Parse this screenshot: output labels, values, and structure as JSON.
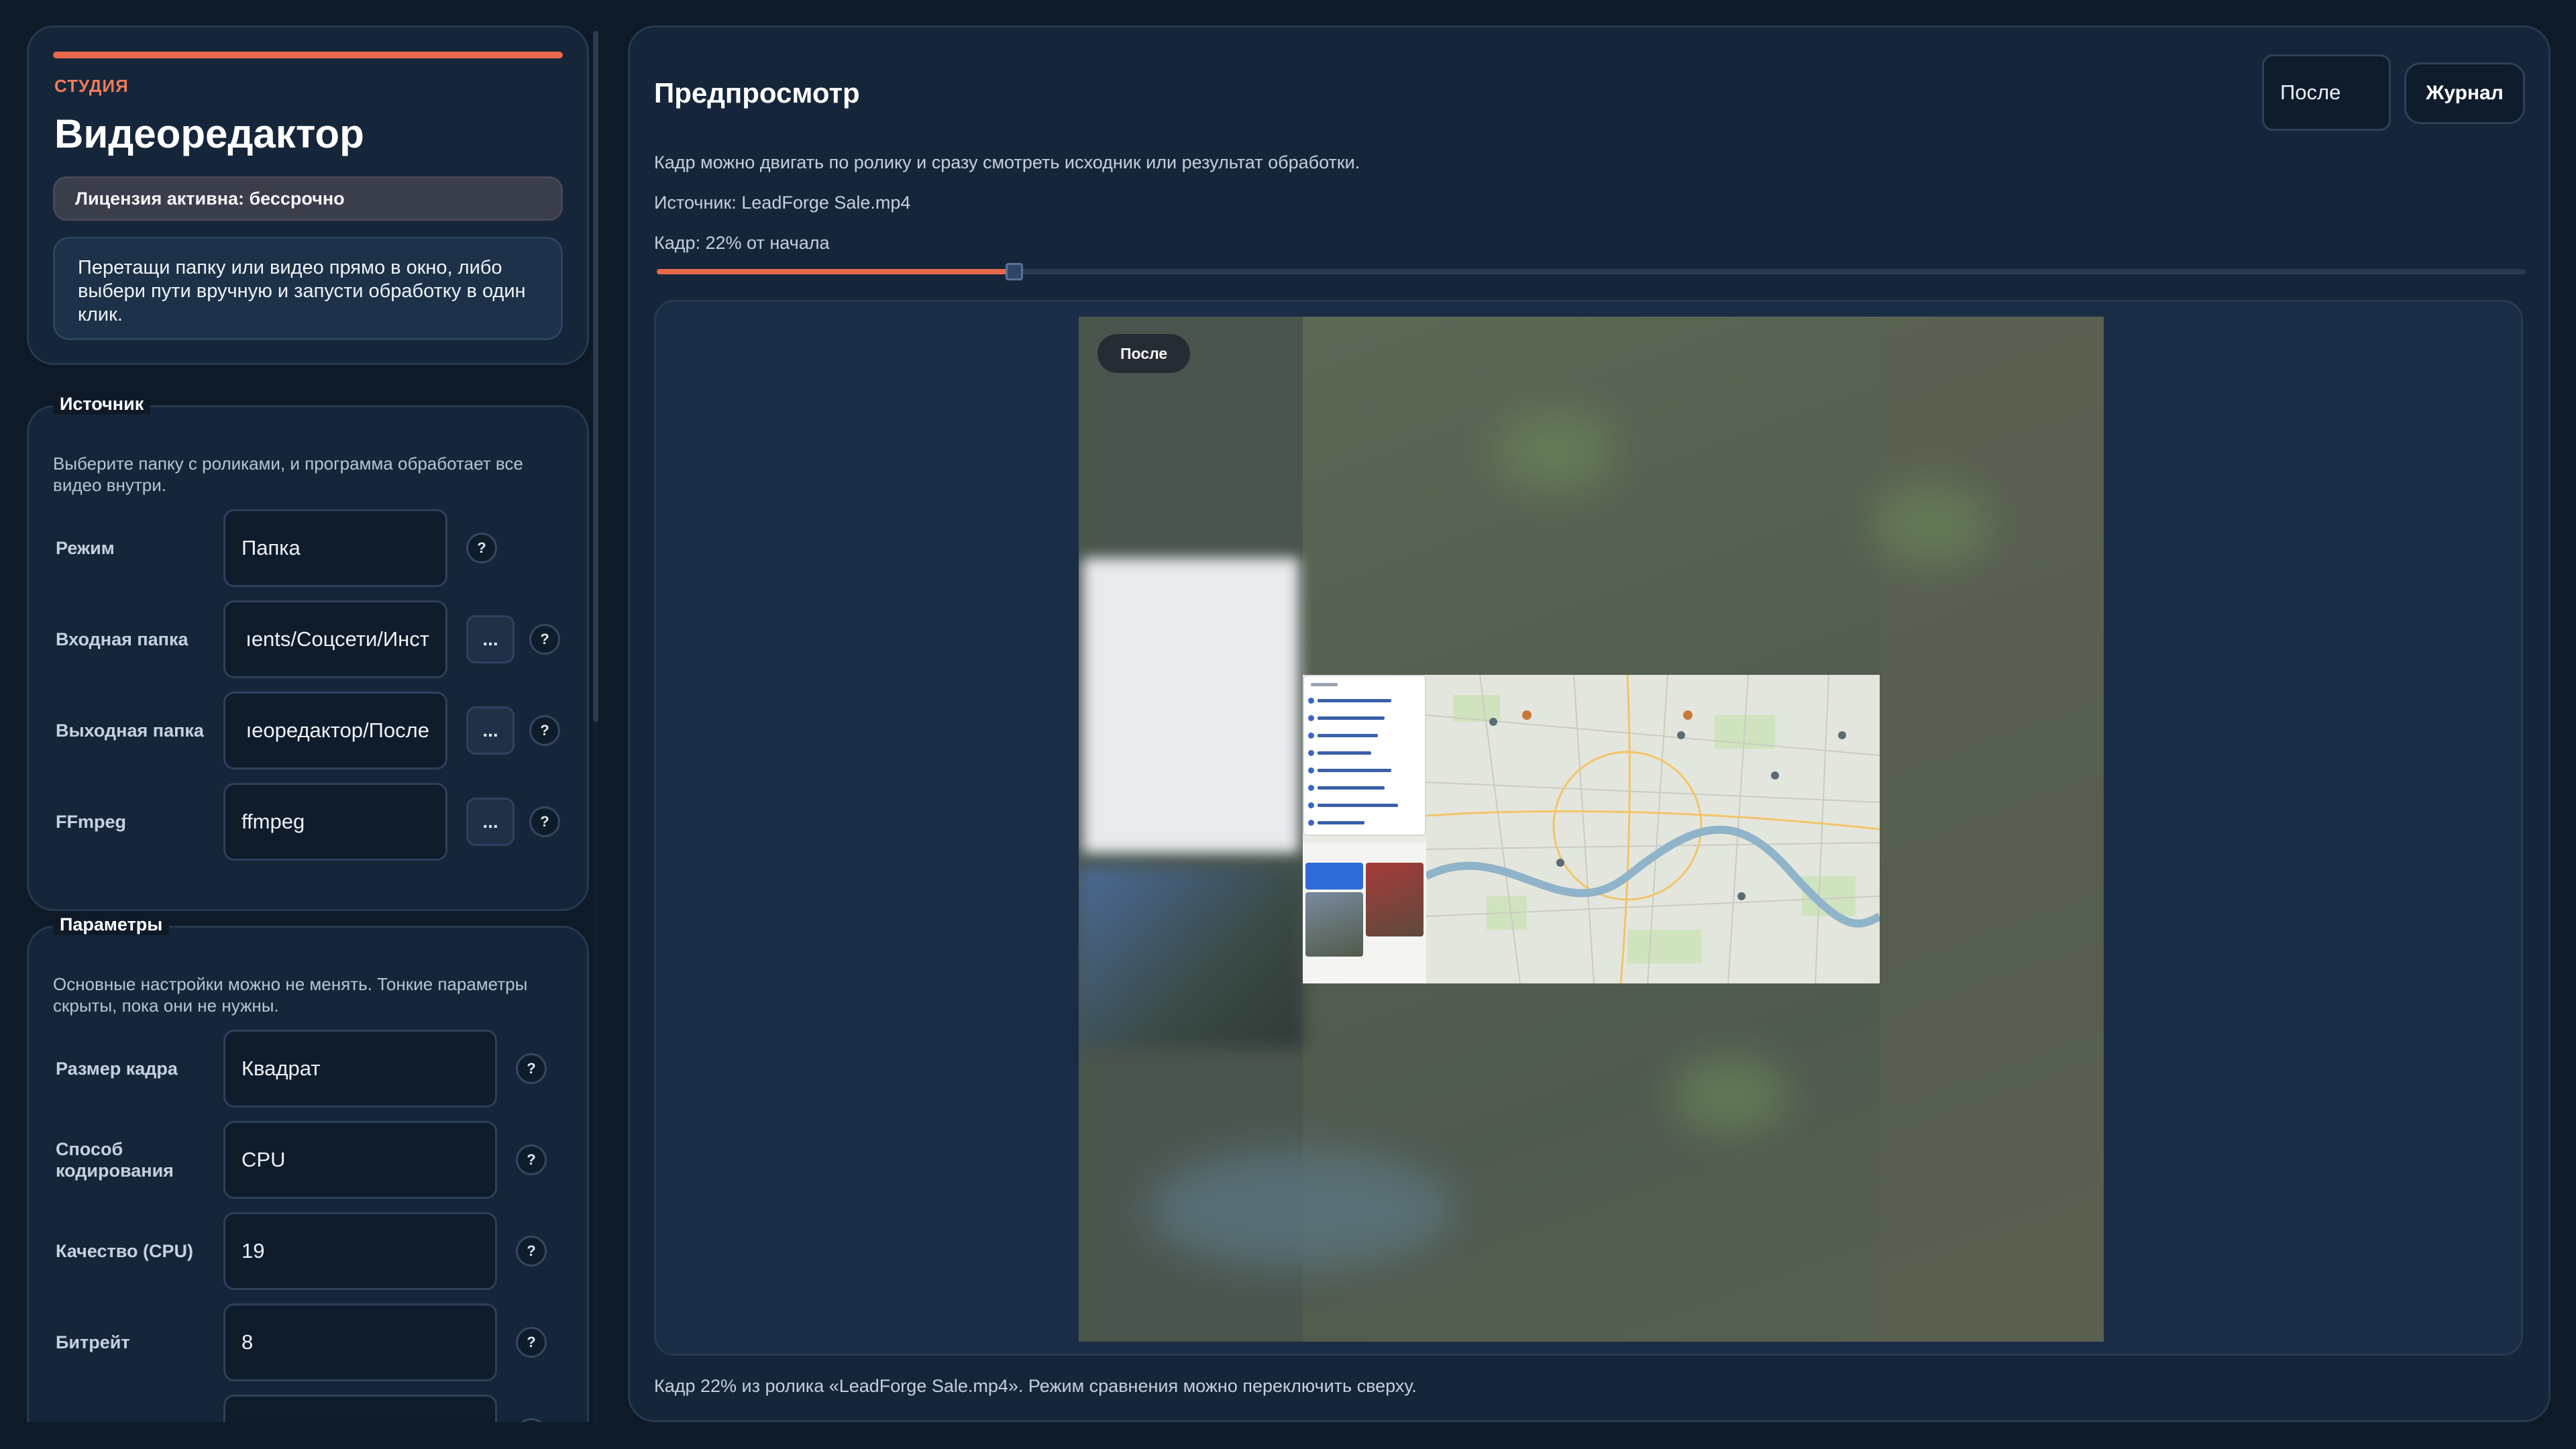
{
  "header": {
    "eyebrow": "СТУДИЯ",
    "title": "Видеоредактор",
    "license": "Лицензия активна: бессрочно",
    "hint": "Перетащи папку или видео прямо в окно, либо выбери пути вручную и запусти обработку в один клик."
  },
  "source": {
    "legend": "Источник",
    "description": "Выберите папку с роликами, и программа обработает все видео внутри.",
    "fields": [
      {
        "label": "Режим",
        "value": "Папка"
      },
      {
        "label": "Входная папка",
        "value": "ıents/Соцсети/Инст"
      },
      {
        "label": "Выходная папка",
        "value": "ıеоредактор/После"
      },
      {
        "label": "FFmpeg",
        "value": "ffmpeg"
      }
    ],
    "browse_label": "...",
    "help_label": "?"
  },
  "params": {
    "legend": "Параметры",
    "description": "Основные настройки можно не менять. Тонкие параметры скрыты, пока они не нужны.",
    "fields": [
      {
        "label": "Размер кадра",
        "value": "Квадрат"
      },
      {
        "label": "Способ кодирования",
        "value": "CPU"
      },
      {
        "label": "Качество (CPU)",
        "value": "19"
      },
      {
        "label": "Битрейт",
        "value": "8"
      }
    ],
    "help_label": "?"
  },
  "preview": {
    "title": "Предпросмотр",
    "mode_value": "После",
    "journal_label": "Журнал",
    "info": "Кадр можно двигать по ролику и сразу смотреть исходник или результат обработки.",
    "source_line": "Источник: LeadForge Sale.mp4",
    "frame_line": "Кадр: 22% от начала",
    "frame_position": 0.22,
    "badge": "После",
    "footer": "Кадр 22% из ролика «LeadForge Sale.mp4». Режим сравнения можно переключить сверху."
  },
  "colors": {
    "accent": "#e8684a",
    "background": "#0f1a29",
    "panel": "#16263a"
  }
}
